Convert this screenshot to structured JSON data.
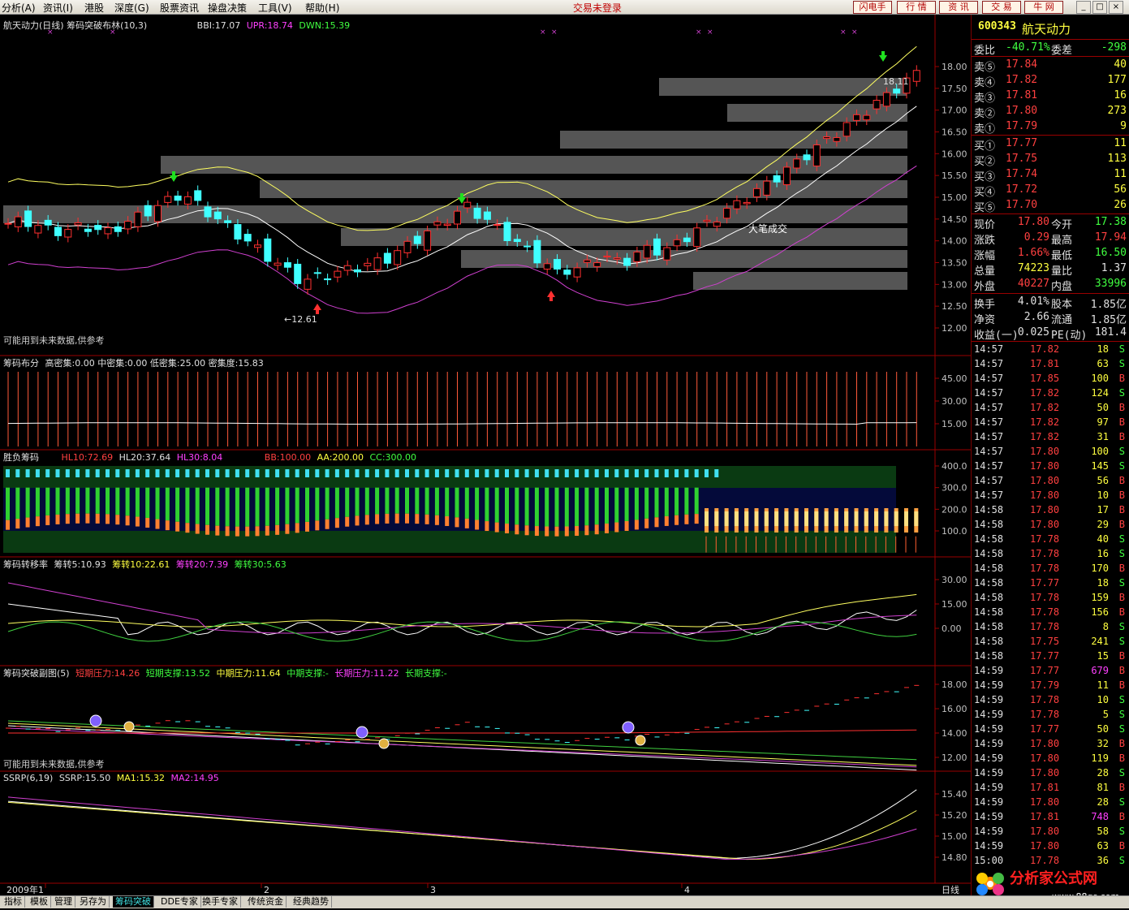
{
  "menu": {
    "items": [
      "分析(A)",
      "资讯(I)",
      "港股",
      "深度(G)",
      "股票资讯",
      "操盘决策",
      "工具(V)",
      "帮助(H)"
    ],
    "login_status": "交易未登录"
  },
  "toolbar": {
    "buttons": [
      "闪电手",
      "行 情",
      "资 讯",
      "交 易",
      "牛 网"
    ],
    "window_controls": [
      "_",
      "□",
      "×"
    ]
  },
  "main_chart": {
    "title": "航天动力(日线) 筹码突破布林(10,3)",
    "bbi": "BBI:17.07",
    "upr": "UPR:18.74",
    "dwn": "DWN:15.39",
    "y_labels": [
      "18.00",
      "17.50",
      "17.00",
      "16.50",
      "16.00",
      "15.50",
      "15.00",
      "14.50",
      "14.00",
      "13.50",
      "13.00",
      "12.50",
      "12.00"
    ],
    "annotation_big_trade": "大笔成交",
    "low_mark": "←12.61",
    "high_mark": "18.11",
    "note": "可能用到未来数据,供参考"
  },
  "chip_dist": {
    "title": "筹码布分",
    "stats": "高密集:0.00 中密集:0.00 低密集:25.00 密集度:15.83",
    "y_labels": [
      "45.00",
      "30.00",
      "15.00"
    ]
  },
  "win_lose": {
    "title": "胜负筹码",
    "hl10": "HL10:72.69",
    "hl20": "HL20:37.64",
    "hl30": "HL30:8.04",
    "bb": "BB:100.00",
    "aa": "AA:200.00",
    "cc": "CC:300.00",
    "y_labels": [
      "400.0",
      "300.0",
      "200.0",
      "100.0"
    ]
  },
  "transfer": {
    "title": "筹码转移率",
    "z5": "筹转5:10.93",
    "z10": "筹转10:22.61",
    "z20": "筹转20:7.39",
    "z30": "筹转30:5.63",
    "y_labels": [
      "30.00",
      "15.00",
      "0.00"
    ]
  },
  "breakout": {
    "title": "筹码突破副图(5)",
    "short_press": "短期压力:14.26",
    "short_support": "短期支撑:13.52",
    "mid_press": "中期压力:11.64",
    "mid_support": "中期支撑:-",
    "long_press": "长期压力:11.22",
    "long_support": "长期支撑:-",
    "y_labels": [
      "18.00",
      "16.00",
      "14.00",
      "12.00"
    ],
    "note": "可能用到未来数据,供参考"
  },
  "ssrp": {
    "title": "SSRP(6,19)",
    "ssrp": "SSRP:15.50",
    "ma1": "MA1:15.32",
    "ma2": "MA2:14.95",
    "y_labels": [
      "15.40",
      "15.20",
      "15.00",
      "14.80"
    ]
  },
  "time_axis": {
    "labels": [
      "2009年1",
      "2",
      "3",
      "4"
    ],
    "period": "日线"
  },
  "quote": {
    "code": "600343",
    "name": "航天动力",
    "wei_bi_label": "委比",
    "wei_bi": "-40.71%",
    "wei_cha_label": "委差",
    "wei_cha": "-298",
    "sells": [
      {
        "label": "卖⑤",
        "price": "17.84",
        "vol": "40"
      },
      {
        "label": "卖④",
        "price": "17.82",
        "vol": "177"
      },
      {
        "label": "卖③",
        "price": "17.81",
        "vol": "16"
      },
      {
        "label": "卖②",
        "price": "17.80",
        "vol": "273"
      },
      {
        "label": "卖①",
        "price": "17.79",
        "vol": "9"
      }
    ],
    "buys": [
      {
        "label": "买①",
        "price": "17.77",
        "vol": "11"
      },
      {
        "label": "买②",
        "price": "17.75",
        "vol": "113"
      },
      {
        "label": "买③",
        "price": "17.74",
        "vol": "11"
      },
      {
        "label": "买④",
        "price": "17.72",
        "vol": "56"
      },
      {
        "label": "买⑤",
        "price": "17.70",
        "vol": "26"
      }
    ],
    "stats": [
      {
        "l1": "现价",
        "v1": "17.80",
        "c1": "#ff4040",
        "l2": "今开",
        "v2": "17.38",
        "c2": "#40ff40"
      },
      {
        "l1": "涨跌",
        "v1": "0.29",
        "c1": "#ff4040",
        "l2": "最高",
        "v2": "17.94",
        "c2": "#ff4040"
      },
      {
        "l1": "涨幅",
        "v1": "1.66%",
        "c1": "#ff4040",
        "l2": "最低",
        "v2": "16.50",
        "c2": "#40ff40"
      },
      {
        "l1": "总量",
        "v1": "74223",
        "c1": "#ffff40",
        "l2": "量比",
        "v2": "1.37",
        "c2": "#e0e0e0"
      },
      {
        "l1": "外盘",
        "v1": "40227",
        "c1": "#ff4040",
        "l2": "内盘",
        "v2": "33996",
        "c2": "#40ff40"
      }
    ],
    "stats2": [
      {
        "l1": "换手",
        "v1": "4.01%",
        "l2": "股本",
        "v2": "1.85亿"
      },
      {
        "l1": "净资",
        "v1": "2.66",
        "l2": "流通",
        "v2": "1.85亿"
      },
      {
        "l1": "收益(一)",
        "v1": "0.025",
        "l2": "PE(动)",
        "v2": "181.4"
      }
    ],
    "ticks": [
      [
        "14:57",
        "17.82",
        "18",
        "S"
      ],
      [
        "14:57",
        "17.81",
        "63",
        "S"
      ],
      [
        "14:57",
        "17.85",
        "100",
        "B"
      ],
      [
        "14:57",
        "17.82",
        "124",
        "S"
      ],
      [
        "14:57",
        "17.82",
        "50",
        "B"
      ],
      [
        "14:57",
        "17.82",
        "97",
        "B"
      ],
      [
        "14:57",
        "17.82",
        "31",
        "B"
      ],
      [
        "14:57",
        "17.80",
        "100",
        "S"
      ],
      [
        "14:57",
        "17.80",
        "145",
        "S"
      ],
      [
        "14:57",
        "17.80",
        "56",
        "B"
      ],
      [
        "14:57",
        "17.80",
        "10",
        "B"
      ],
      [
        "14:58",
        "17.80",
        "17",
        "B"
      ],
      [
        "14:58",
        "17.80",
        "29",
        "B"
      ],
      [
        "14:58",
        "17.78",
        "40",
        "S"
      ],
      [
        "14:58",
        "17.78",
        "16",
        "S"
      ],
      [
        "14:58",
        "17.78",
        "170",
        "B"
      ],
      [
        "14:58",
        "17.77",
        "18",
        "S"
      ],
      [
        "14:58",
        "17.78",
        "159",
        "B"
      ],
      [
        "14:58",
        "17.78",
        "156",
        "B"
      ],
      [
        "14:58",
        "17.78",
        "8",
        "S"
      ],
      [
        "14:58",
        "17.75",
        "241",
        "S"
      ],
      [
        "14:58",
        "17.77",
        "15",
        "B"
      ],
      [
        "14:59",
        "17.77",
        "679",
        "B"
      ],
      [
        "14:59",
        "17.79",
        "11",
        "B"
      ],
      [
        "14:59",
        "17.78",
        "10",
        "S"
      ],
      [
        "14:59",
        "17.78",
        "5",
        "S"
      ],
      [
        "14:59",
        "17.77",
        "50",
        "S"
      ],
      [
        "14:59",
        "17.80",
        "32",
        "B"
      ],
      [
        "14:59",
        "17.80",
        "119",
        "B"
      ],
      [
        "14:59",
        "17.80",
        "28",
        "S"
      ],
      [
        "14:59",
        "17.81",
        "81",
        "B"
      ],
      [
        "14:59",
        "17.80",
        "28",
        "S"
      ],
      [
        "14:59",
        "17.81",
        "748",
        "B"
      ],
      [
        "14:59",
        "17.80",
        "58",
        "S"
      ],
      [
        "14:59",
        "17.80",
        "63",
        "B"
      ],
      [
        "15:00",
        "17.78",
        "36",
        "S"
      ]
    ]
  },
  "bottom_tabs": [
    "指标",
    "模板",
    "管理",
    "另存为",
    "筹码突破",
    "DDE专家",
    "换手专家",
    "传统资金",
    "经典趋势"
  ],
  "logo": {
    "text": "分析家公式网",
    "url": "www.88gs.com"
  },
  "colors": {
    "up": "#ff3030",
    "down": "#40ffff",
    "bbi": "#ffffff",
    "upper": "#ffff60",
    "lower": "#d040d0",
    "accent": "#40e0e0"
  }
}
